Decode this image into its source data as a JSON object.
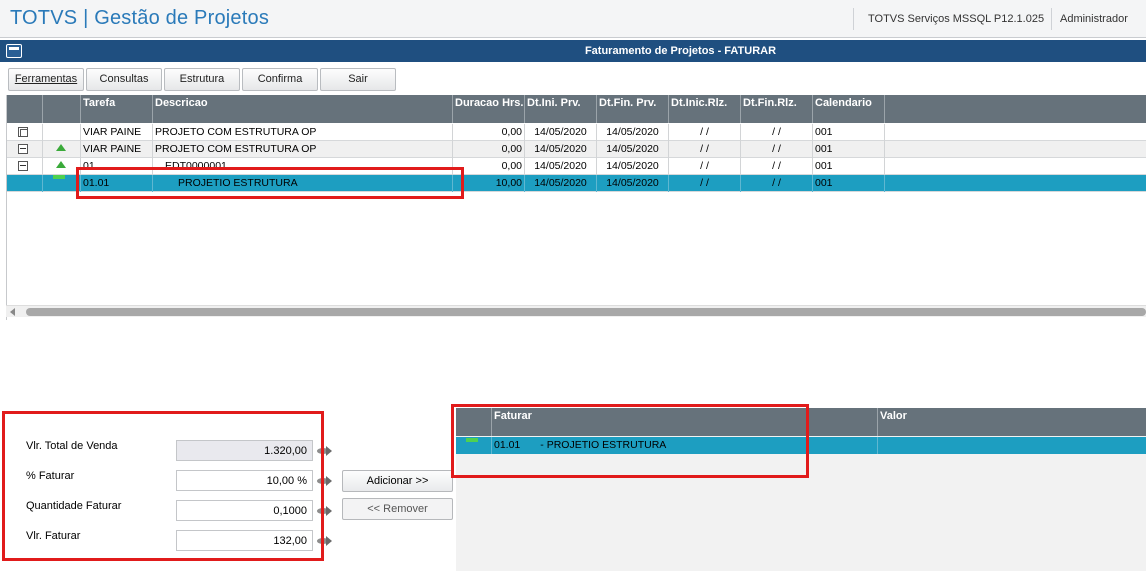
{
  "header": {
    "app_title": "TOTVS | Gestão de Projetos",
    "server": "TOTVS Serviços MSSQL P12.1.025",
    "user": "Administrador"
  },
  "window": {
    "title": "Faturamento de Projetos - FATURAR"
  },
  "toolbar": {
    "buttons": [
      "Ferramentas",
      "Consultas",
      "Estrutura",
      "Confirma",
      "Sair"
    ]
  },
  "grid": {
    "columns": [
      "Tarefa",
      "Descricao",
      "Duracao Hrs.",
      "Dt.Ini. Prv.",
      "Dt.Fin. Prv.",
      "Dt.Inic.Rlz.",
      "Dt.Fin.Rlz.",
      "Calendario"
    ],
    "rows": [
      {
        "icon": "tree-box-icon",
        "tarefa": "VIAR PAINE",
        "descricao": "PROJETO COM ESTRUTURA OP",
        "duracao": "0,00",
        "ini_prv": "14/05/2020",
        "fin_prv": "14/05/2020",
        "ini_rlz": "/  /",
        "fin_rlz": "/  /",
        "calendario": "001"
      },
      {
        "icon": "tree-minus-icon",
        "status": "green-triangle-icon",
        "tarefa": "VIAR PAINE",
        "descricao": "PROJETO COM ESTRUTURA OP",
        "duracao": "0,00",
        "ini_prv": "14/05/2020",
        "fin_prv": "14/05/2020",
        "ini_rlz": "/  /",
        "fin_rlz": "/  /",
        "calendario": "001"
      },
      {
        "icon": "tree-minus-icon",
        "status": "green-triangle-icon",
        "tarefa": "01",
        "descricao": "EDT0000001",
        "duracao": "0,00",
        "ini_prv": "14/05/2020",
        "fin_prv": "14/05/2020",
        "ini_rlz": "/  /",
        "fin_rlz": "/  /",
        "calendario": "001"
      },
      {
        "status": "green-bar-icon",
        "tarefa": "01.01",
        "descricao": "PROJETIO ESTRUTURA",
        "duracao": "10,00",
        "ini_prv": "14/05/2020",
        "fin_prv": "14/05/2020",
        "ini_rlz": "/  /",
        "fin_rlz": "/  /",
        "calendario": "001"
      }
    ]
  },
  "form": {
    "vlr_total_label": "Vlr. Total de Venda",
    "vlr_total_value": "1.320,00",
    "pct_label": "% Faturar",
    "pct_value": "10,00 %",
    "qtd_label": "Quantidade Faturar",
    "qtd_value": "0,1000",
    "vlr_fat_label": "Vlr. Faturar",
    "vlr_fat_value": "132,00"
  },
  "actions": {
    "add_label": "Adicionar >>",
    "remove_label": "<< Remover"
  },
  "invoice_grid": {
    "columns": [
      "Faturar",
      "Valor"
    ],
    "rows": [
      {
        "faturar_code": "01.01",
        "faturar_desc": "- PROJETIO ESTRUTURA",
        "valor": ""
      }
    ]
  },
  "colors": {
    "title_blue": "#2a7ab9",
    "window_bar": "#1f4f80",
    "grid_header": "#66727b",
    "selected_row": "#1d9ec1",
    "highlight_red": "#e11b1b"
  }
}
